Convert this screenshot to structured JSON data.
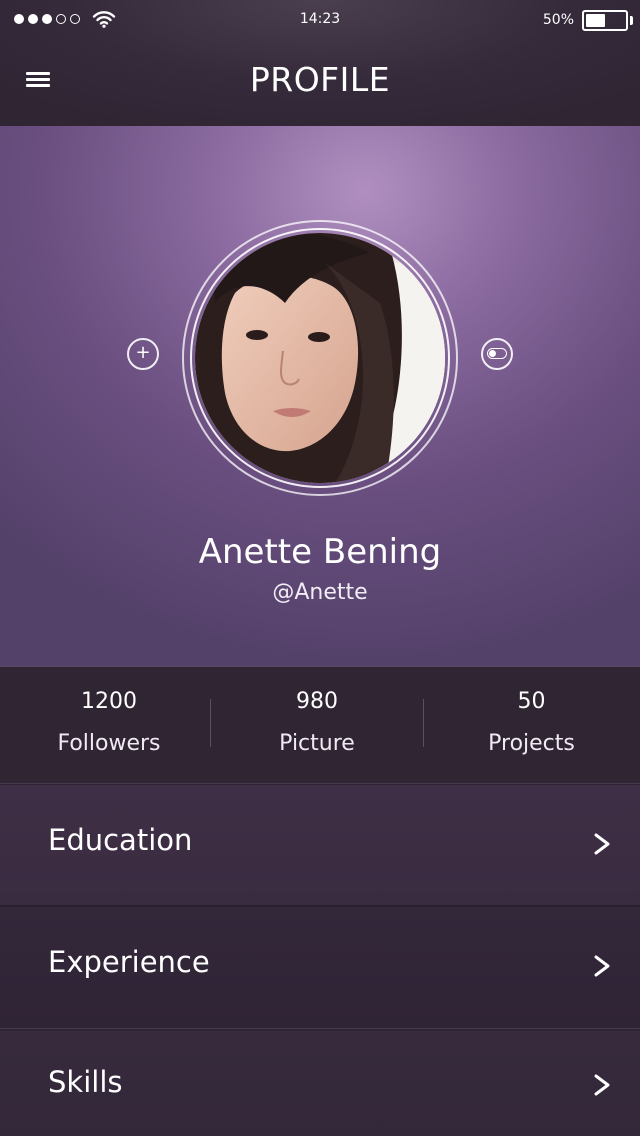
{
  "status_bar": {
    "signal_dots_filled": 3,
    "signal_dots_total": 5,
    "time": "14:23",
    "battery_percent": "50%",
    "battery_level": 0.5
  },
  "nav": {
    "title": "PROFILE",
    "menu_icon": "hamburger-menu-icon"
  },
  "profile": {
    "name": "Anette Bening",
    "handle": "@Anette",
    "avatar": "profile-photo",
    "left_action_icon": "plus-icon",
    "right_action_icon": "toggle-icon"
  },
  "stats": [
    {
      "value": "1200",
      "label": "Followers"
    },
    {
      "value": "980",
      "label": "Picture"
    },
    {
      "value": "50",
      "label": "Projects"
    }
  ],
  "menu": [
    {
      "label": "Education",
      "icon": "chevron-right-icon"
    },
    {
      "label": "Experience",
      "icon": "chevron-right-icon"
    },
    {
      "label": "Skills",
      "icon": "chevron-right-icon"
    }
  ],
  "colors": {
    "header_bg": "#352a3a",
    "hero_light": "#b08fc0",
    "hero_dark": "#54416a",
    "stats_bg": "#302533",
    "list_bg": "#392b40",
    "text": "#ffffff"
  }
}
